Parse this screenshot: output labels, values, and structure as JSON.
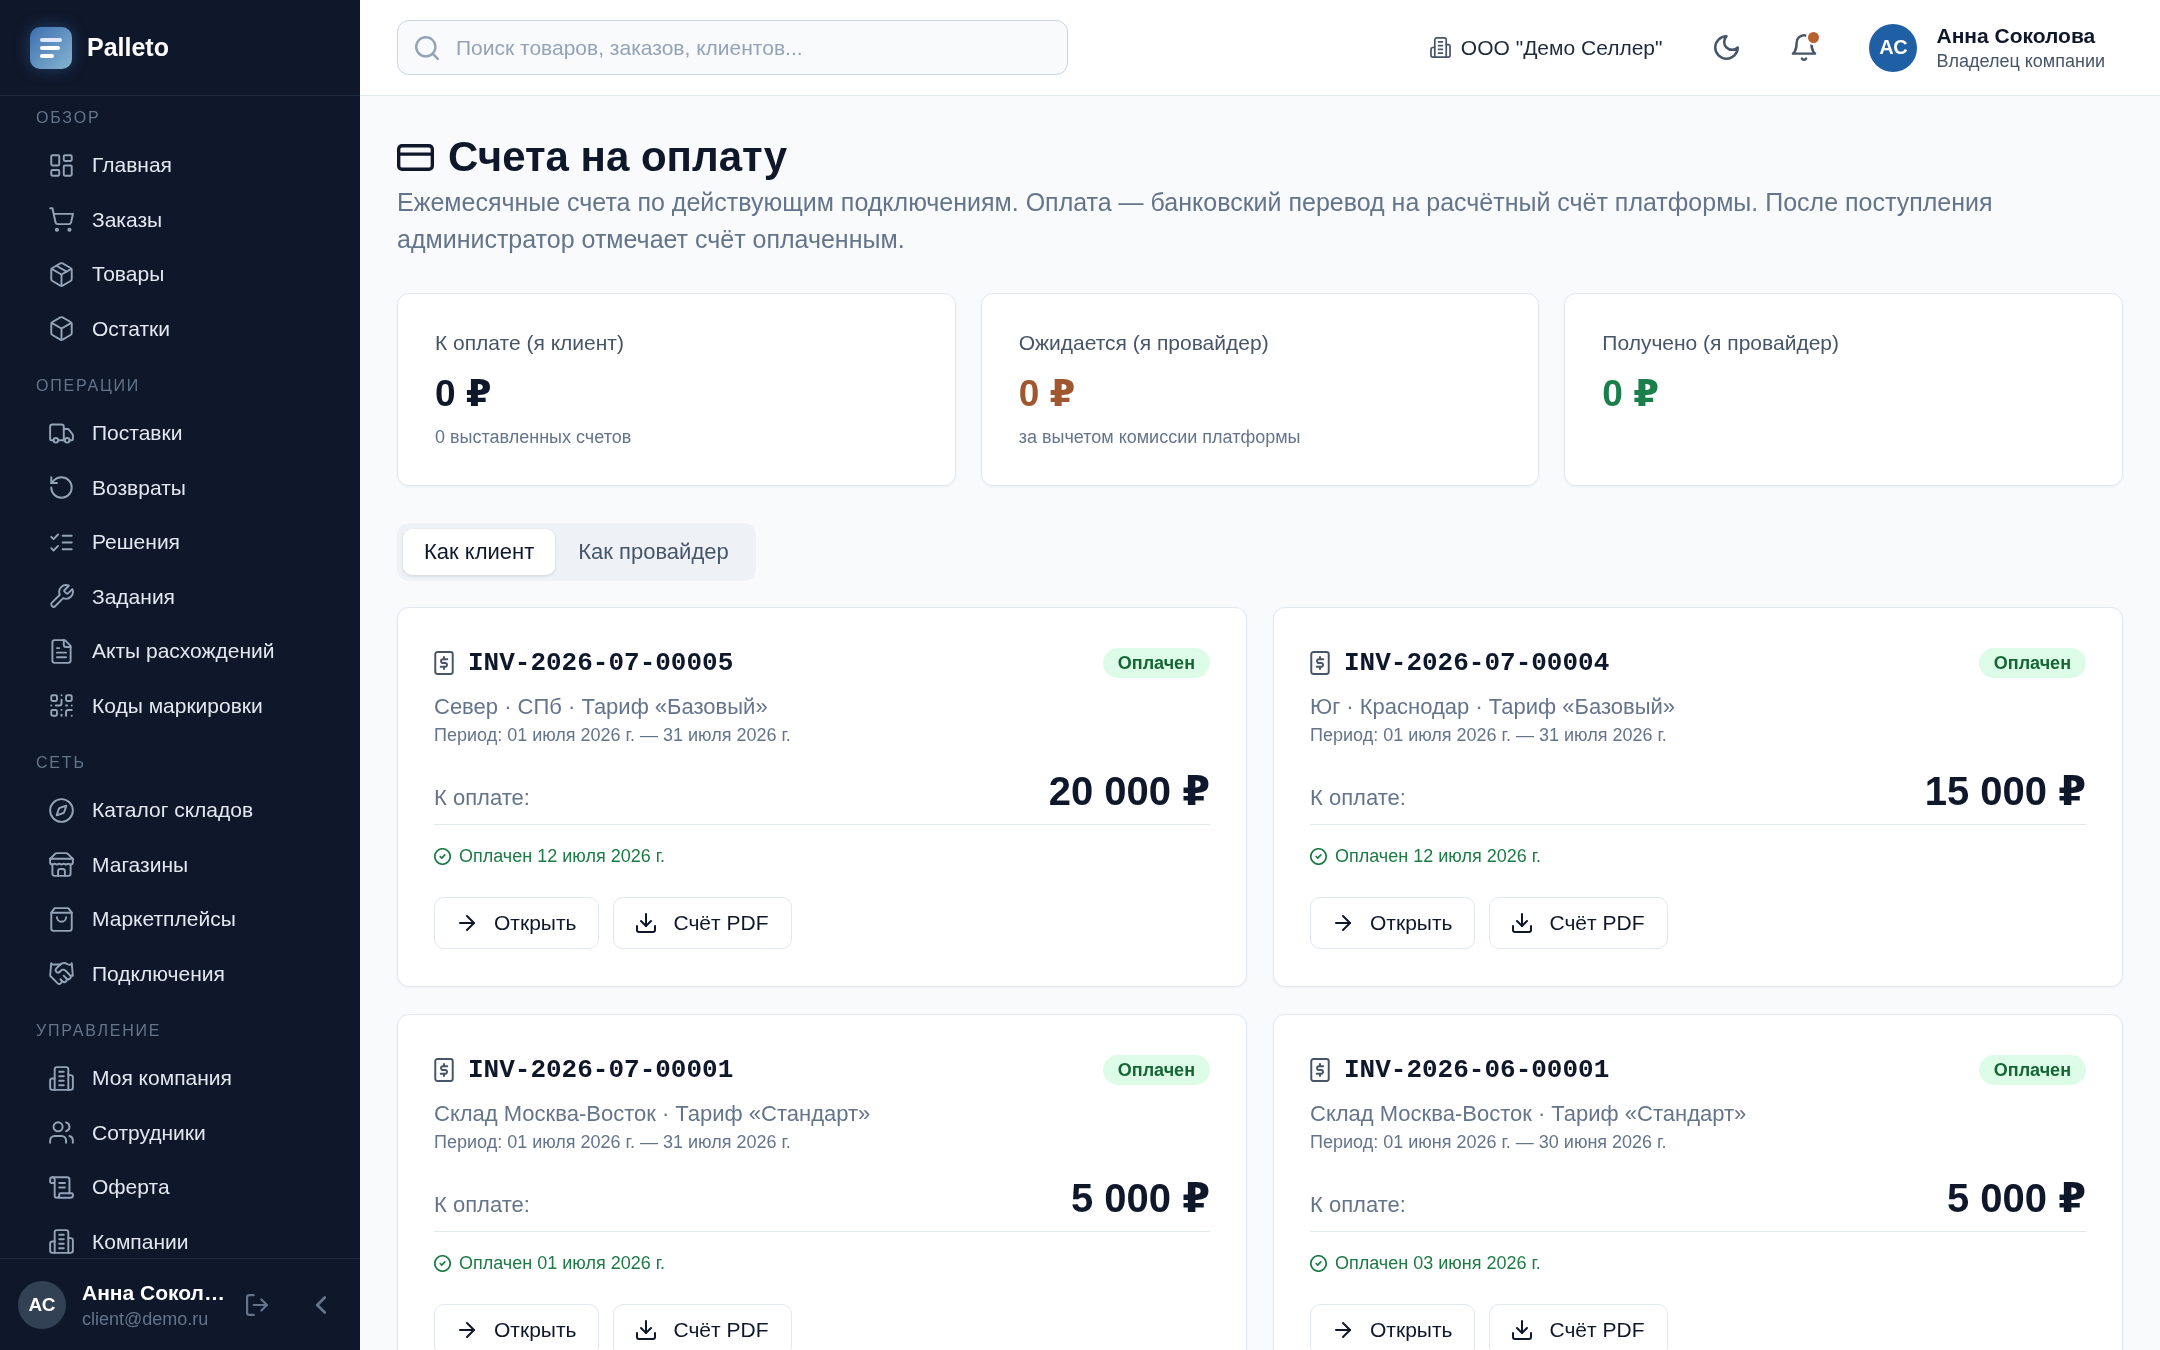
{
  "app": {
    "name": "Palleto"
  },
  "sidebar": {
    "sections": [
      {
        "title": "ОБЗОР",
        "items": [
          {
            "label": "Главная",
            "selected": false
          },
          {
            "label": "Заказы",
            "selected": false
          },
          {
            "label": "Товары",
            "selected": false
          },
          {
            "label": "Остатки",
            "selected": false
          }
        ]
      },
      {
        "title": "ОПЕРАЦИИ",
        "items": [
          {
            "label": "Поставки",
            "selected": false
          },
          {
            "label": "Возвраты",
            "selected": false
          },
          {
            "label": "Решения",
            "selected": false
          },
          {
            "label": "Задания",
            "selected": false
          },
          {
            "label": "Акты расхождений",
            "selected": false
          },
          {
            "label": "Коды маркировки",
            "selected": false
          }
        ]
      },
      {
        "title": "СЕТЬ",
        "items": [
          {
            "label": "Каталог складов",
            "selected": false
          },
          {
            "label": "Магазины",
            "selected": false
          },
          {
            "label": "Маркетплейсы",
            "selected": false
          },
          {
            "label": "Подключения",
            "selected": false
          }
        ]
      },
      {
        "title": "УПРАВЛЕНИЕ",
        "items": [
          {
            "label": "Моя компания",
            "selected": false
          },
          {
            "label": "Сотрудники",
            "selected": false
          },
          {
            "label": "Оферта",
            "selected": false
          },
          {
            "label": "Компании",
            "selected": false
          }
        ]
      }
    ],
    "user": {
      "initials": "АС",
      "name": "Анна Сокол…",
      "email": "client@demo.ru"
    }
  },
  "header": {
    "search": {
      "placeholder": "Поиск товаров, заказов, клиентов..."
    },
    "company": "ООО \"Демо Селлер\"",
    "notifications": {
      "unread": true
    },
    "user": {
      "initials": "АС",
      "name": "Анна Соколова",
      "role": "Владелец компании"
    }
  },
  "page": {
    "title": "Счета на оплату",
    "description": "Ежемесячные счета по действующим подключениям. Оплата — банковский перевод на расчётный счёт платформы. После поступления администратор отмечает счёт оплаченным."
  },
  "stats": [
    {
      "label": "К оплате (я клиент)",
      "value": "0 ₽",
      "color": "#0f172a",
      "note": "0 выставленных счетов"
    },
    {
      "label": "Ожидается (я провайдер)",
      "value": "0 ₽",
      "color": "#a0572f",
      "note": "за вычетом комиссии платформы"
    },
    {
      "label": "Получено (я провайдер)",
      "value": "0 ₽",
      "color": "#1a7f4b"
    }
  ],
  "tabs": [
    {
      "label": "Как клиент",
      "selected": true
    },
    {
      "label": "Как провайдер",
      "selected": false
    }
  ],
  "invoices": [
    {
      "number": "INV-2026-07-00005",
      "status": {
        "label": "Оплачен",
        "kind": "paid"
      },
      "subtitle": "Север · СПб · Тариф «Базовый»",
      "period": "Период: 01 июля 2026 г. — 31 июля 2026 г.",
      "amount_label": "К оплате:",
      "amount": "20 000 ₽",
      "paid_note": "Оплачен 12 июля 2026 г.",
      "actions": [
        {
          "label": "Открыть",
          "kind": "open"
        },
        {
          "label": "Счёт PDF",
          "kind": "download"
        }
      ]
    },
    {
      "number": "INV-2026-07-00004",
      "status": {
        "label": "Оплачен",
        "kind": "paid"
      },
      "subtitle": "Юг · Краснодар · Тариф «Базовый»",
      "period": "Период: 01 июля 2026 г. — 31 июля 2026 г.",
      "amount_label": "К оплате:",
      "amount": "15 000 ₽",
      "paid_note": "Оплачен 12 июля 2026 г.",
      "actions": [
        {
          "label": "Открыть",
          "kind": "open"
        },
        {
          "label": "Счёт PDF",
          "kind": "download"
        }
      ]
    },
    {
      "number": "INV-2026-07-00001",
      "status": {
        "label": "Оплачен",
        "kind": "paid"
      },
      "subtitle": "Склад Москва-Восток · Тариф «Стандарт»",
      "period": "Период: 01 июля 2026 г. — 31 июля 2026 г.",
      "amount_label": "К оплате:",
      "amount": "5 000 ₽",
      "paid_note": "Оплачен 01 июля 2026 г.",
      "actions": [
        {
          "label": "Открыть",
          "kind": "open"
        },
        {
          "label": "Счёт PDF",
          "kind": "download"
        }
      ]
    },
    {
      "number": "INV-2026-06-00001",
      "status": {
        "label": "Оплачен",
        "kind": "paid"
      },
      "subtitle": "Склад Москва-Восток · Тариф «Стандарт»",
      "period": "Период: 01 июня 2026 г. — 30 июня 2026 г.",
      "amount_label": "К оплате:",
      "amount": "5 000 ₽",
      "paid_note": "Оплачен 03 июня 2026 г.",
      "actions": [
        {
          "label": "Открыть",
          "kind": "open"
        },
        {
          "label": "Счёт PDF",
          "kind": "download"
        }
      ]
    }
  ]
}
